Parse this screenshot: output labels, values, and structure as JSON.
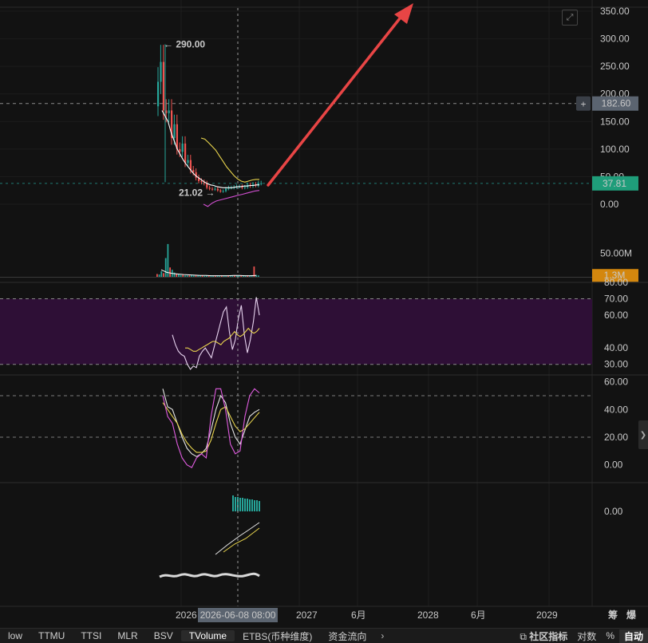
{
  "chart_data": {
    "type": "line",
    "panes": [
      {
        "name": "price",
        "y_ticks": [
          "350.00",
          "300.00",
          "250.00",
          "200.00",
          "150.00",
          "100.00",
          "50.00",
          "0.00"
        ],
        "y_values": [
          350,
          300,
          250,
          200,
          150,
          100,
          50,
          0
        ],
        "ylim": [
          0,
          350
        ],
        "high_label": "← 290.00",
        "low_label": "21.02 →",
        "high_value": 290.0,
        "low_value": 21.02,
        "crosshair_price": "182.60",
        "crosshair_value": 182.6,
        "last_price": "37.81",
        "last_value": 37.81,
        "close_series": [
          222,
          258,
          170,
          165,
          170,
          120,
          145,
          100,
          95,
          110,
          75,
          80,
          62,
          58,
          48,
          42,
          40,
          38,
          30,
          28,
          27,
          28,
          25,
          23,
          24,
          28,
          30,
          30,
          31,
          32,
          32,
          30,
          31,
          35,
          33,
          36,
          34,
          38,
          38
        ],
        "ma_series": [
          {
            "color": "#ffffff",
            "values": [
              170,
              160,
              150,
              130,
              115,
              100,
              90,
              80,
              72,
              65,
              58,
              52,
              48,
              44,
              40,
              37,
              35,
              34,
              32,
              31,
              30,
              30,
              30,
              30,
              31,
              32,
              32,
              33,
              33,
              34,
              34,
              35,
              35
            ]
          },
          {
            "color": "#e8d44d",
            "values": [
              120,
              118,
              112,
              105,
              98,
              88,
              78,
              68,
              60,
              52,
              46,
              42,
              40,
              42,
              44,
              45,
              45
            ]
          },
          {
            "color": "#d14fd1",
            "values": [
              0,
              -4,
              2,
              6,
              8,
              10,
              12,
              14,
              16,
              18,
              20,
              22,
              24,
              25
            ]
          }
        ]
      },
      {
        "name": "volume",
        "y_ticks": [
          "50.00M"
        ],
        "y_values": [
          50
        ],
        "ylim": [
          0,
          80
        ],
        "last_label": "1.3M",
        "last_value": 1.3,
        "bars": [
          6,
          5,
          12,
          8,
          40,
          70,
          20,
          15,
          9,
          6,
          5,
          4,
          4,
          3,
          3,
          3,
          4,
          3,
          3,
          3,
          3,
          3,
          2,
          3,
          3,
          3,
          3,
          3,
          3,
          2,
          3,
          3,
          3,
          3,
          3,
          3,
          3,
          3,
          3,
          3,
          3,
          3,
          3,
          3,
          3,
          22,
          4,
          3
        ]
      },
      {
        "name": "rsi",
        "y_ticks": [
          "80.00",
          "70.00",
          "60.00",
          "40.00",
          "30.00"
        ],
        "y_values": [
          80,
          70,
          60,
          40,
          30
        ],
        "ylim": [
          25,
          80
        ],
        "band": [
          30,
          70
        ],
        "series": [
          {
            "color": "#e6d3ee",
            "values": [
              48,
              42,
              38,
              36,
              35,
              30,
              27,
              29,
              28,
              35,
              38,
              40,
              37,
              34,
              41,
              48,
              55,
              62,
              65,
              50,
              39,
              45,
              58,
              66,
              48,
              37,
              45,
              56,
              71,
              60
            ]
          },
          {
            "color": "#e8d44d",
            "values": [
              40,
              40,
              39,
              38,
              38,
              39,
              40,
              41,
              42,
              43,
              44,
              44,
              43,
              42,
              44,
              45,
              46,
              48,
              50,
              48,
              47,
              48,
              50,
              52,
              50,
              49,
              50,
              52
            ]
          }
        ]
      },
      {
        "name": "kdj",
        "y_ticks": [
          "60.00",
          "40.00",
          "20.00",
          "0.00"
        ],
        "y_values": [
          60,
          40,
          20,
          0
        ],
        "ylim": [
          -10,
          65
        ],
        "lines": [
          50,
          20
        ],
        "series": [
          {
            "color": "#e6e6e6",
            "values": [
              55,
              42,
              40,
              30,
              20,
              12,
              8,
              6,
              8,
              12,
              25,
              40,
              50,
              45,
              30,
              20,
              15,
              25,
              35,
              38,
              40
            ]
          },
          {
            "color": "#e8d44d",
            "values": [
              45,
              40,
              35,
              30,
              22,
              16,
              12,
              9,
              9,
              10,
              18,
              30,
              40,
              42,
              35,
              28,
              24,
              26,
              30,
              34,
              38
            ]
          },
          {
            "color": "#e05ce0",
            "values": [
              50,
              35,
              30,
              15,
              5,
              0,
              -2,
              5,
              8,
              5,
              35,
              55,
              55,
              40,
              15,
              8,
              10,
              35,
              50,
              55,
              52
            ]
          }
        ]
      },
      {
        "name": "indicator",
        "y_ticks": [
          "0.00"
        ],
        "y_values": [
          0
        ],
        "bars": [
          20,
          18,
          18,
          17,
          17,
          16,
          16,
          15,
          15,
          14,
          14,
          13
        ]
      }
    ],
    "x_axis": {
      "labels": [
        "2026",
        "2027",
        "6月",
        "2028",
        "6月",
        "2029"
      ],
      "crosshair_label": "2026-06-08 08:00",
      "right_labels": [
        "筹",
        "爆"
      ]
    }
  },
  "bottom_tabs": [
    "low",
    "TTMU",
    "TTSI",
    "MLR",
    "BSV",
    "TVolume",
    "ETBS(币种维度)",
    "资金流向"
  ],
  "active_tab": "TVolume",
  "bottom_right": [
    "社区指标",
    "对数",
    "%",
    "自动"
  ],
  "active_right": "自动",
  "colors": {
    "up": "#26a69a",
    "down": "#ef5350",
    "rsi_band": "#2e0f36",
    "arrow": "#e84545",
    "last_price_bg": "#1f9d7a",
    "volume_label_bg": "#d4870e",
    "crosshair_bg": "#5b6470"
  }
}
